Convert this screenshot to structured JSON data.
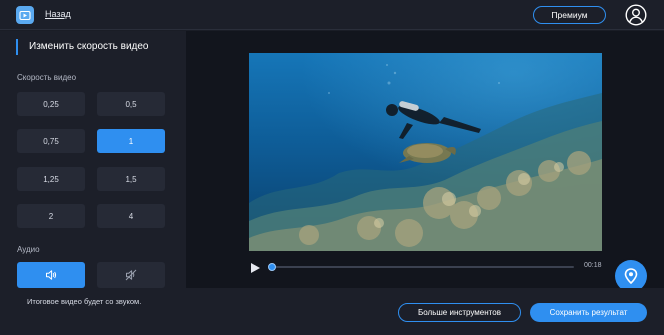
{
  "header": {
    "logo_icon": "video-editor-logo-icon",
    "back_label": "Назад",
    "premium_label": "Премиум",
    "account_icon": "user-circle-icon"
  },
  "panel": {
    "title": "Изменить скорость видео",
    "speed_label": "Скорость видео",
    "speeds": [
      {
        "label": "0,25",
        "selected": false
      },
      {
        "label": "0,5",
        "selected": false
      },
      {
        "label": "0,75",
        "selected": false
      },
      {
        "label": "1",
        "selected": true
      },
      {
        "label": "1,25",
        "selected": false
      },
      {
        "label": "1,5",
        "selected": false
      },
      {
        "label": "2",
        "selected": false
      },
      {
        "label": "4",
        "selected": false
      }
    ],
    "audio_label": "Аудио",
    "audio_on_icon": "speaker-icon",
    "audio_off_icon": "speaker-muted-icon",
    "audio_selected": "on",
    "audio_note": "Итоговое видео будет со звуком."
  },
  "player": {
    "play_icon": "play-icon",
    "progress": 0.0,
    "time": "00:18"
  },
  "floating": {
    "icon": "location-pin-icon"
  },
  "footer": {
    "more_tools_label": "Больше инструментов",
    "save_label": "Сохранить результат"
  },
  "colors": {
    "accent": "#2f8ff0",
    "background": "#1a1d26",
    "panel": "#1c1f29",
    "button": "#262a36"
  }
}
